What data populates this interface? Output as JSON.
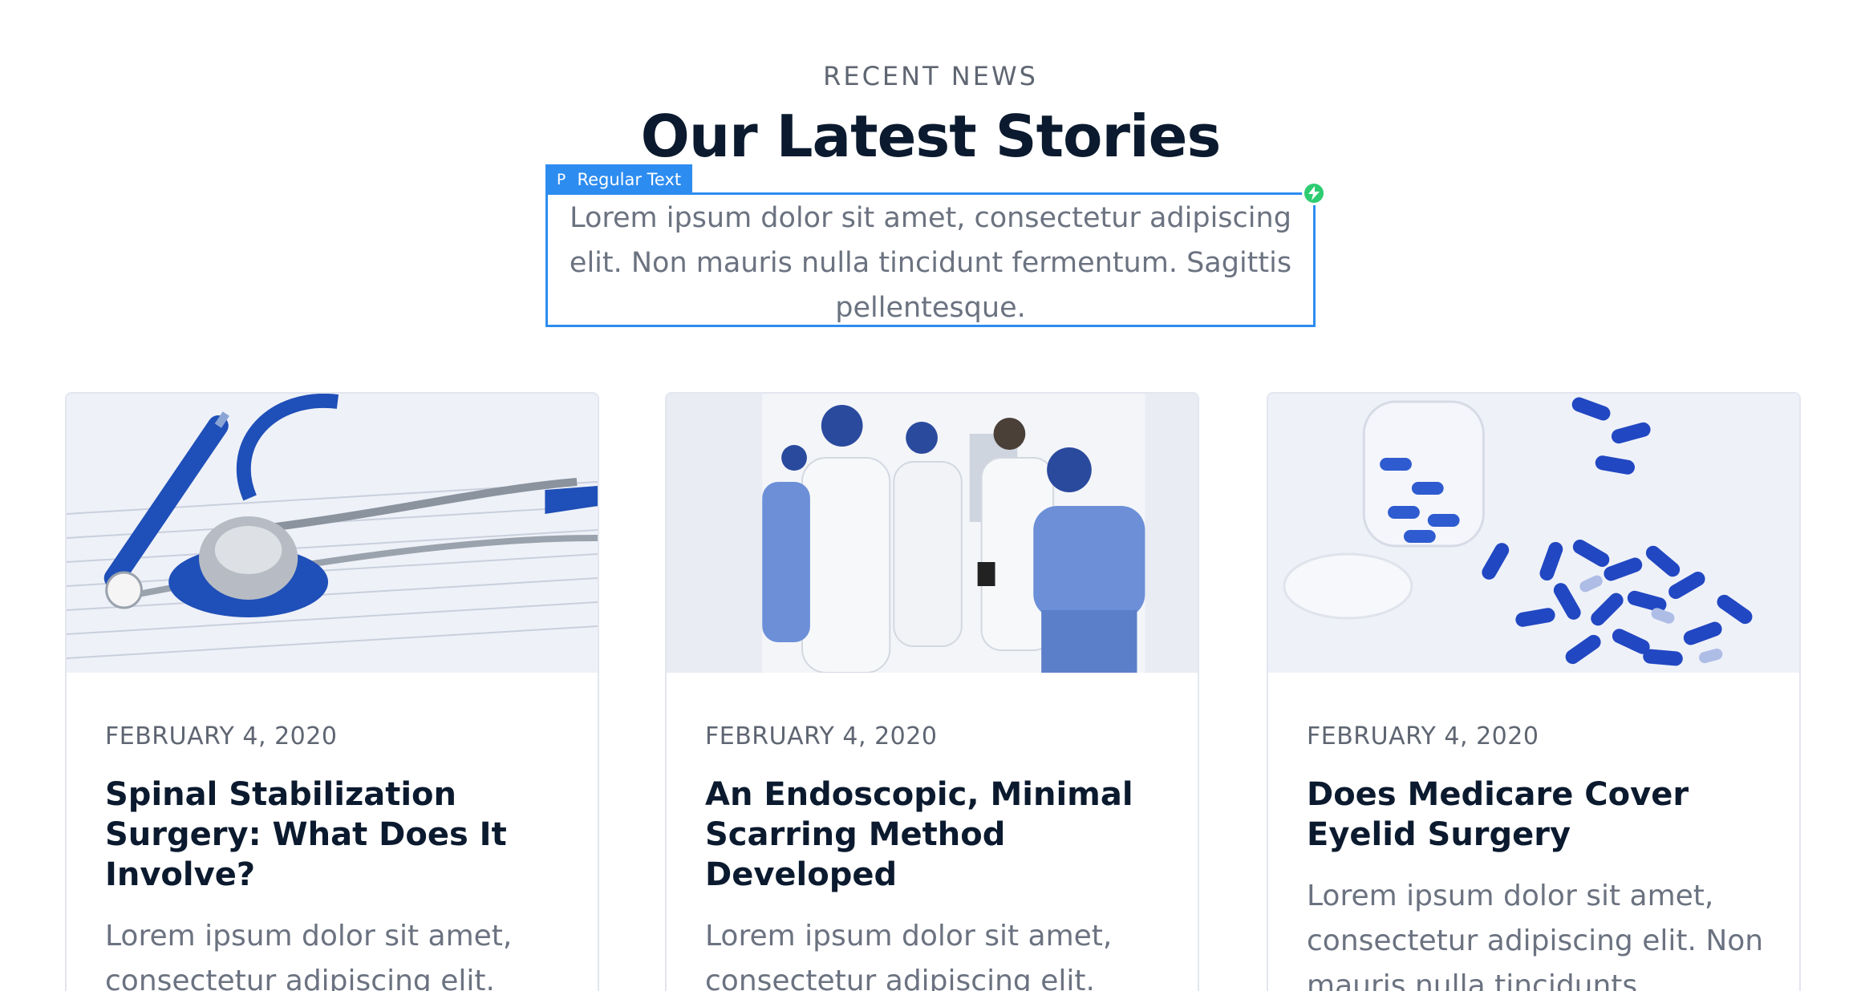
{
  "section": {
    "eyebrow": "RECENT NEWS",
    "heading": "Our Latest Stories",
    "lead": "Lorem ipsum dolor sit amet, consectetur adipiscing elit. Non mauris nulla tincidunt fermentum. Sagittis pellentesque."
  },
  "editor": {
    "tag_icon": "P",
    "tag_label": "Regular Text",
    "accent": "#2d8cf0",
    "badge_color": "#2ecc71"
  },
  "cards": [
    {
      "image": "stethoscope-on-document",
      "date": "FEBRUARY 4, 2020",
      "title": "Spinal Stabilization Surgery: What Does It Involve?",
      "excerpt": "Lorem ipsum dolor sit amet, consectetur adipiscing elit."
    },
    {
      "image": "medical-staff-walking-hallway",
      "date": "FEBRUARY 4, 2020",
      "title": "An Endoscopic, Minimal Scarring Method Developed",
      "excerpt": "Lorem ipsum dolor sit amet, consectetur adipiscing elit."
    },
    {
      "image": "blue-capsules-and-jar",
      "date": "FEBRUARY 4, 2020",
      "title": "Does Medicare Cover Eyelid Surgery",
      "excerpt": "Lorem ipsum dolor sit amet, consectetur adipiscing elit. Non mauris nulla tincidunts"
    }
  ]
}
